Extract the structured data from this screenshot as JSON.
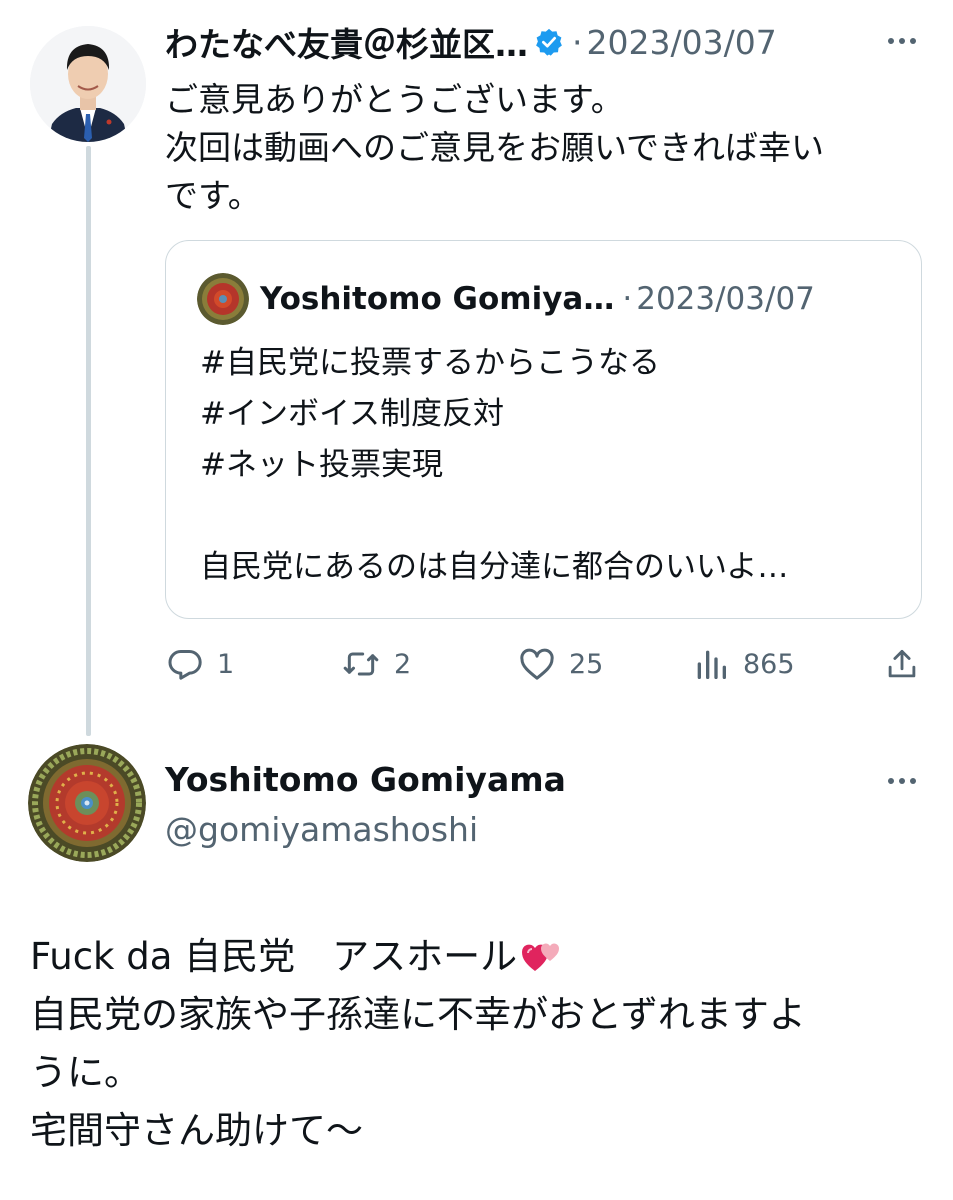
{
  "colors": {
    "text": "#0f1419",
    "muted": "#536471",
    "verified": "#1d9bf0",
    "border": "#cfd9de",
    "emoji": "#e0245e"
  },
  "reply_tweet": {
    "author_name": "わたなべ友貴＠杉並区…",
    "dot": "·",
    "date": "2023/03/07",
    "lines": [
      "ご意見ありがとうございます。",
      "次回は動画へのご意見をお願いできれば幸い",
      "です。"
    ],
    "quoted": {
      "author_name": "Yoshitomo Gomiya…",
      "dot": "·",
      "date": "2023/03/07",
      "lines": [
        "#自民党に投票するからこうなる",
        "#インボイス制度反対",
        "#ネット投票実現",
        "",
        "自民党にあるのは自分達に都合のいいよ…"
      ]
    },
    "actions": {
      "reply_count": "1",
      "retweet_count": "2",
      "like_count": "25",
      "views_count": "865",
      "icons": [
        "reply-icon",
        "retweet-icon",
        "like-icon",
        "views-icon",
        "share-icon"
      ]
    }
  },
  "main_tweet": {
    "author_name": "Yoshitomo Gomiyama",
    "handle": "@gomiyamashoshi",
    "lines": [
      "Fuck da 自民党　アスホール",
      "自民党の家族や子孫達に不幸がおとずれますよ",
      "うに。",
      "宅間守さん助けて〜"
    ],
    "emoji": "💞"
  }
}
